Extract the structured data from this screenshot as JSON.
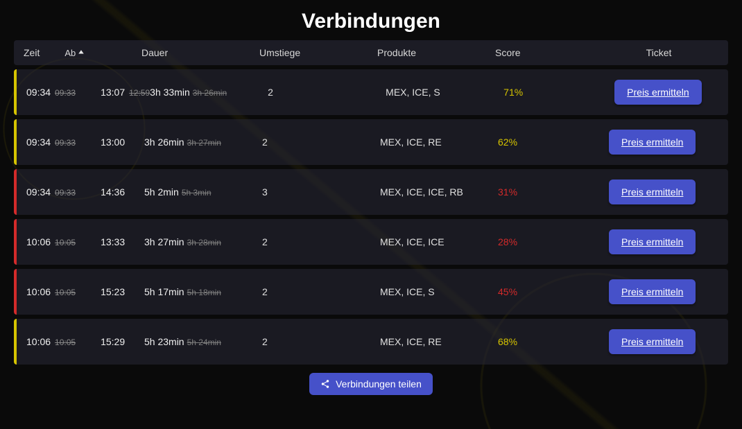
{
  "title": "Verbindungen",
  "headers": {
    "zeit": "Zeit",
    "ab": "Ab",
    "dauer": "Dauer",
    "umstiege": "Umstiege",
    "produkte": "Produkte",
    "score": "Score",
    "ticket": "Ticket"
  },
  "ticket_button_label": "Preis ermitteln",
  "share_button_label": "Verbindungen teilen",
  "rows": [
    {
      "border": "yellow",
      "dep": "09:34",
      "dep_old": "09:33",
      "arr": "13:07",
      "arr_old": "12:59",
      "dur": "3h 33min",
      "dur_old": "3h 26min",
      "umst": "2",
      "prod": "MEX, ICE, S",
      "score": "71%",
      "score_class": "yellow"
    },
    {
      "border": "yellow",
      "dep": "09:34",
      "dep_old": "09:33",
      "arr": "13:00",
      "arr_old": "",
      "dur": "3h 26min",
      "dur_old": "3h 27min",
      "umst": "2",
      "prod": "MEX, ICE, RE",
      "score": "62%",
      "score_class": "yellow"
    },
    {
      "border": "red",
      "dep": "09:34",
      "dep_old": "09:33",
      "arr": "14:36",
      "arr_old": "",
      "dur": "5h 2min",
      "dur_old": "5h 3min",
      "umst": "3",
      "prod": "MEX, ICE, ICE, RB",
      "score": "31%",
      "score_class": "red"
    },
    {
      "border": "red",
      "dep": "10:06",
      "dep_old": "10:05",
      "arr": "13:33",
      "arr_old": "",
      "dur": "3h 27min",
      "dur_old": "3h 28min",
      "umst": "2",
      "prod": "MEX, ICE, ICE",
      "score": "28%",
      "score_class": "red"
    },
    {
      "border": "red",
      "dep": "10:06",
      "dep_old": "10:05",
      "arr": "15:23",
      "arr_old": "",
      "dur": "5h 17min",
      "dur_old": "5h 18min",
      "umst": "2",
      "prod": "MEX, ICE, S",
      "score": "45%",
      "score_class": "red"
    },
    {
      "border": "yellow",
      "dep": "10:06",
      "dep_old": "10:05",
      "arr": "15:29",
      "arr_old": "",
      "dur": "5h 23min",
      "dur_old": "5h 24min",
      "umst": "2",
      "prod": "MEX, ICE, RE",
      "score": "68%",
      "score_class": "yellow"
    }
  ]
}
